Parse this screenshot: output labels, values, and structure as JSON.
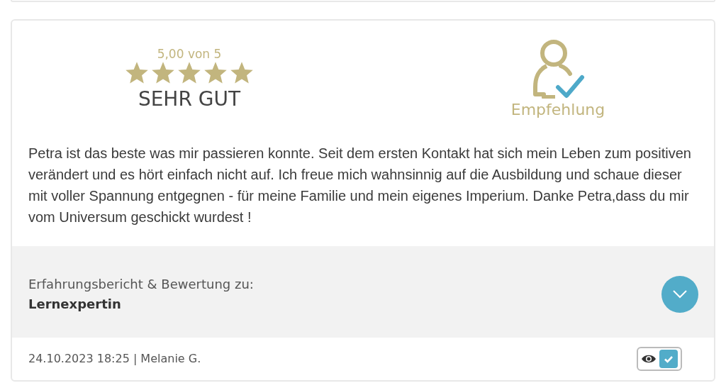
{
  "rating": {
    "score": "5,00 von 5",
    "stars": 5,
    "verdict": "SEHR GUT"
  },
  "recommendation": {
    "label": "Empfehlung"
  },
  "review_text": "Petra ist das beste was mir passieren konnte. Seit dem ersten Kontakt hat sich mein Leben zum positiven verändert und es hört einfach nicht auf. Ich freue mich wahnsinnig auf die Ausbildung und schaue dieser mit voller Spannung entgegnen - für meine Familie und mein eigenes Imperium. Danke Petra,dass du mir vom Universum geschickt wurdest !",
  "subject": {
    "label": "Erfahrungsbericht & Bewertung zu:",
    "name": "Lernexpertin",
    "expanded": false
  },
  "footer": {
    "meta": "24.10.2023 18:25 | Melanie G.",
    "verified": true
  }
}
